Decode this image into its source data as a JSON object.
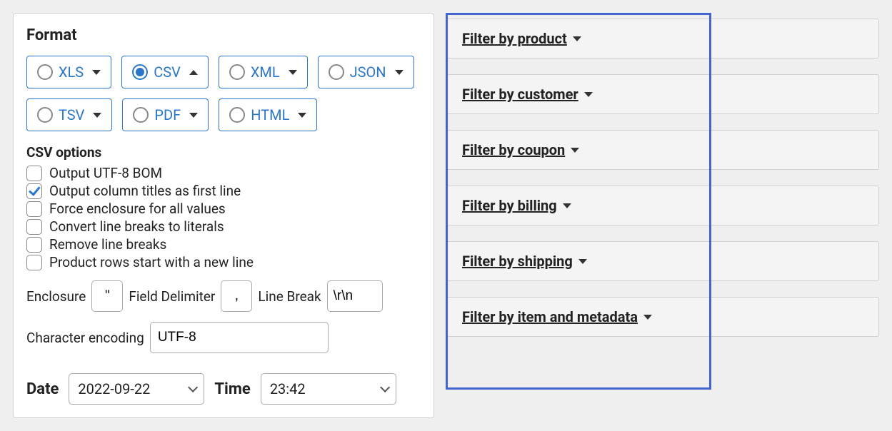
{
  "format": {
    "title": "Format",
    "options": [
      {
        "label": "XLS",
        "selected": false,
        "expanded": false
      },
      {
        "label": "CSV",
        "selected": true,
        "expanded": true
      },
      {
        "label": "XML",
        "selected": false,
        "expanded": false
      },
      {
        "label": "JSON",
        "selected": false,
        "expanded": false
      },
      {
        "label": "TSV",
        "selected": false,
        "expanded": false
      },
      {
        "label": "PDF",
        "selected": false,
        "expanded": false
      },
      {
        "label": "HTML",
        "selected": false,
        "expanded": false
      }
    ]
  },
  "csv_options": {
    "title": "CSV options",
    "checkboxes": [
      {
        "label": "Output UTF-8 BOM",
        "checked": false
      },
      {
        "label": "Output column titles as first line",
        "checked": true
      },
      {
        "label": "Force enclosure for all values",
        "checked": false
      },
      {
        "label": "Convert line breaks to literals",
        "checked": false
      },
      {
        "label": "Remove line breaks",
        "checked": false
      },
      {
        "label": "Product rows start with a new line",
        "checked": false
      }
    ],
    "enclosure_label": "Enclosure",
    "enclosure_value": "\"",
    "delimiter_label": "Field Delimiter",
    "delimiter_value": ",",
    "linebreak_label": "Line Break",
    "linebreak_value": "\\r\\n",
    "encoding_label": "Character encoding",
    "encoding_value": "UTF-8"
  },
  "datetime": {
    "date_label": "Date",
    "date_value": "2022-09-22",
    "time_label": "Time",
    "time_value": "23:42"
  },
  "filters": [
    {
      "label": "Filter by product "
    },
    {
      "label": "Filter by customer "
    },
    {
      "label": "Filter by coupon "
    },
    {
      "label": "Filter by billing "
    },
    {
      "label": "Filter by shipping "
    },
    {
      "label": "Filter by item and metadata "
    }
  ]
}
